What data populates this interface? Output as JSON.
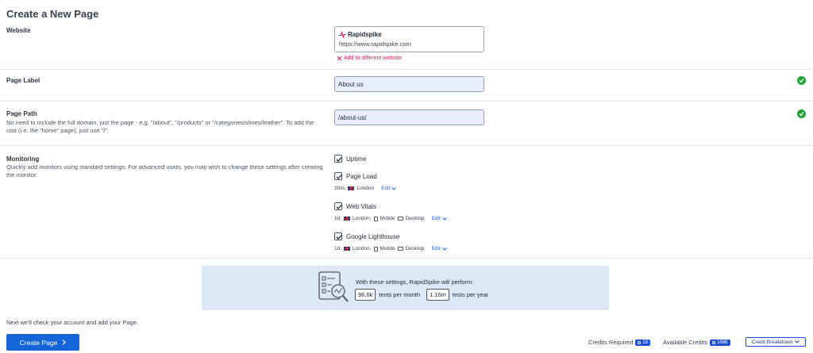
{
  "page": {
    "title": "Create a New Page"
  },
  "website": {
    "label": "Website",
    "site_name": "Rapidspike",
    "site_url": "https://www.rapidspike.com",
    "add_different": "Add to different website"
  },
  "page_label": {
    "label": "Page Label",
    "value": "About us"
  },
  "page_path": {
    "label": "Page Path",
    "description": "No need to include the full domain, just the page - e.g. \"/about\", \"/products\" or \"/categories/shoes/leather\". To add the root (i.e. the \"home\" page), just use \"/\".",
    "value": "/about-us/"
  },
  "monitoring": {
    "label": "Monitoring",
    "description": "Quickly add monitors using standard settings. For advanced users, you may wish to change these settings after creating the monitor.",
    "monitors": [
      {
        "name": "Uptime",
        "checked": true
      },
      {
        "name": "Page Load",
        "checked": true,
        "interval": "30m,",
        "location": "London",
        "edit": "Edit"
      },
      {
        "name": "Web Vitals",
        "checked": true,
        "interval": "1d,",
        "location": "London,",
        "mobile": "Mobile",
        "desktop": "Desktop",
        "edit": "Edit"
      },
      {
        "name": "Google Lighthouse",
        "checked": true,
        "interval": "1d,",
        "location": "London,",
        "mobile": "Mobile",
        "desktop": "Desktop",
        "edit": "Edit"
      }
    ]
  },
  "summary": {
    "text": "With these settings, RapidSpike will perform:",
    "tests_month": "96.6k",
    "tests_month_label": "tests per month",
    "tests_year": "1.16m",
    "tests_year_label": "tests per year"
  },
  "footer": {
    "note": "Next we'll check your account and add your Page.",
    "create_label": "Create Page",
    "credits_required_label": "Credits Required",
    "credits_required": "18",
    "available_label": "Available Credits",
    "available": "1686",
    "breakdown_label": "Credit Breakdown"
  },
  "colors": {
    "primary": "#1565d8",
    "success": "#22a33a",
    "danger": "#d81b60",
    "summary_bg": "#dce8f6"
  }
}
